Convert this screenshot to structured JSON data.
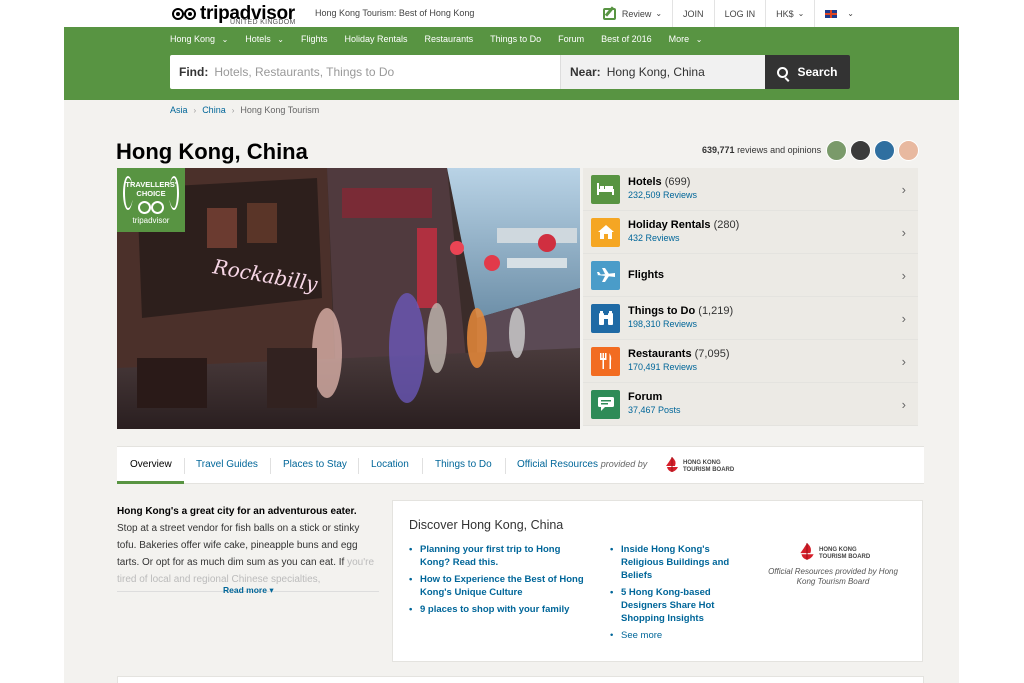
{
  "topbar": {
    "logo_text": "tripadvisor",
    "logo_sub": "UNITED KINGDOM",
    "page_title": "Hong Kong Tourism: Best of Hong Kong",
    "nav": [
      {
        "label": "Review",
        "icon": "review-pencil-icon",
        "dropdown": true
      },
      {
        "label": "JOIN"
      },
      {
        "label": "LOG IN"
      },
      {
        "label": "HK$",
        "dropdown": true
      },
      {
        "label": "",
        "icon": "uk-flag-icon",
        "dropdown": true
      }
    ]
  },
  "nav": {
    "items": [
      {
        "label": "Hong Kong",
        "dropdown": true
      },
      {
        "label": "Hotels",
        "dropdown": true
      },
      {
        "label": "Flights"
      },
      {
        "label": "Holiday Rentals"
      },
      {
        "label": "Restaurants"
      },
      {
        "label": "Things to Do"
      },
      {
        "label": "Forum"
      },
      {
        "label": "Best of 2016"
      },
      {
        "label": "More",
        "dropdown": true
      }
    ]
  },
  "search": {
    "find_label": "Find:",
    "find_placeholder": "Hotels, Restaurants, Things to Do",
    "near_label": "Near:",
    "near_value": "Hong Kong, China",
    "button_label": "Search"
  },
  "breadcrumb": [
    "Asia",
    "China",
    "Hong Kong Tourism"
  ],
  "page": {
    "title": "Hong Kong, China",
    "reviews_count": "639,771",
    "reviews_suffix": "reviews and opinions"
  },
  "badge": {
    "line1": "TRAVELLERS'",
    "line2": "CHOICE",
    "brand": "tripadvisor"
  },
  "categories": [
    {
      "name": "Hotels",
      "count": "(699)",
      "sub": "232,509 Reviews",
      "icon": "bed-icon",
      "color": "#589442"
    },
    {
      "name": "Holiday Rentals",
      "count": "(280)",
      "sub": "432 Reviews",
      "icon": "house-icon",
      "color": "#f5a623"
    },
    {
      "name": "Flights",
      "count": "",
      "sub": "",
      "icon": "plane-icon",
      "color": "#4a9cc9"
    },
    {
      "name": "Things to Do",
      "count": "(1,219)",
      "sub": "198,310 Reviews",
      "icon": "binoculars-icon",
      "color": "#1f6aa5"
    },
    {
      "name": "Restaurants",
      "count": "(7,095)",
      "sub": "170,491 Reviews",
      "icon": "fork-knife-icon",
      "color": "#f26c21"
    },
    {
      "name": "Forum",
      "count": "",
      "sub": "37,467 Posts",
      "icon": "speech-bubble-icon",
      "color": "#2e8b57"
    }
  ],
  "tabs": {
    "items": [
      "Overview",
      "Travel Guides",
      "Places to Stay",
      "Location",
      "Things to Do"
    ],
    "official": "Official Resources",
    "provided_by": "provided by",
    "hktb_line1": "HONG KONG",
    "hktb_line2": "TOURISM BOARD"
  },
  "intro": {
    "bold": "Hong Kong's a great city for an adventurous eater.",
    "text": "Stop at a street vendor for fish balls on a stick or stinky tofu. Bakeries offer wife cake, pineapple buns and egg tarts. Or opt for as much dim sum as you can eat. If",
    "faded": "you're tired of local and regional Chinese specialties,",
    "read_more": "Read more"
  },
  "discover": {
    "title": "Discover Hong Kong, China",
    "col1": [
      "Planning your first trip to Hong Kong? Read this.",
      "How to Experience the Best of Hong Kong's Unique Culture",
      "9 places to shop with your family"
    ],
    "col2": [
      "Inside Hong Kong's Religious Buildings and Beliefs",
      "5 Hong Kong-based Designers Share Hot Shopping Insights"
    ],
    "see_more": "See more",
    "official_caption": "Official Resources provided by Hong Kong Tourism Board"
  },
  "colors": {
    "brand_green": "#589442",
    "link_blue": "#006699",
    "dark_button": "#333333"
  }
}
